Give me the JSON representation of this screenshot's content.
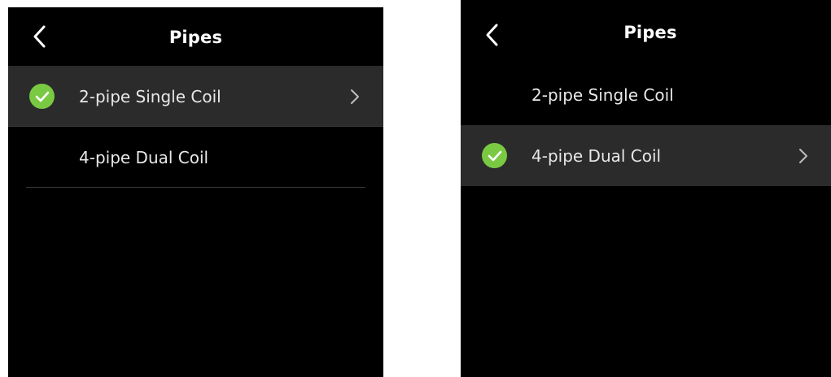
{
  "screens": [
    {
      "title": "Pipes",
      "items": [
        {
          "label": "2-pipe Single Coil",
          "selected": true
        },
        {
          "label": "4-pipe Dual Coil",
          "selected": false
        }
      ]
    },
    {
      "title": "Pipes",
      "items": [
        {
          "label": "2-pipe Single Coil",
          "selected": false
        },
        {
          "label": "4-pipe Dual Coil",
          "selected": true
        }
      ]
    }
  ],
  "colors": {
    "background": "#000000",
    "selected_row": "#2b2b2b",
    "check_green": "#7ac943",
    "text": "#e8e8e8"
  },
  "icons": {
    "back": "chevron-left-icon",
    "check": "check-circle-icon",
    "row_arrow": "chevron-right-icon"
  }
}
